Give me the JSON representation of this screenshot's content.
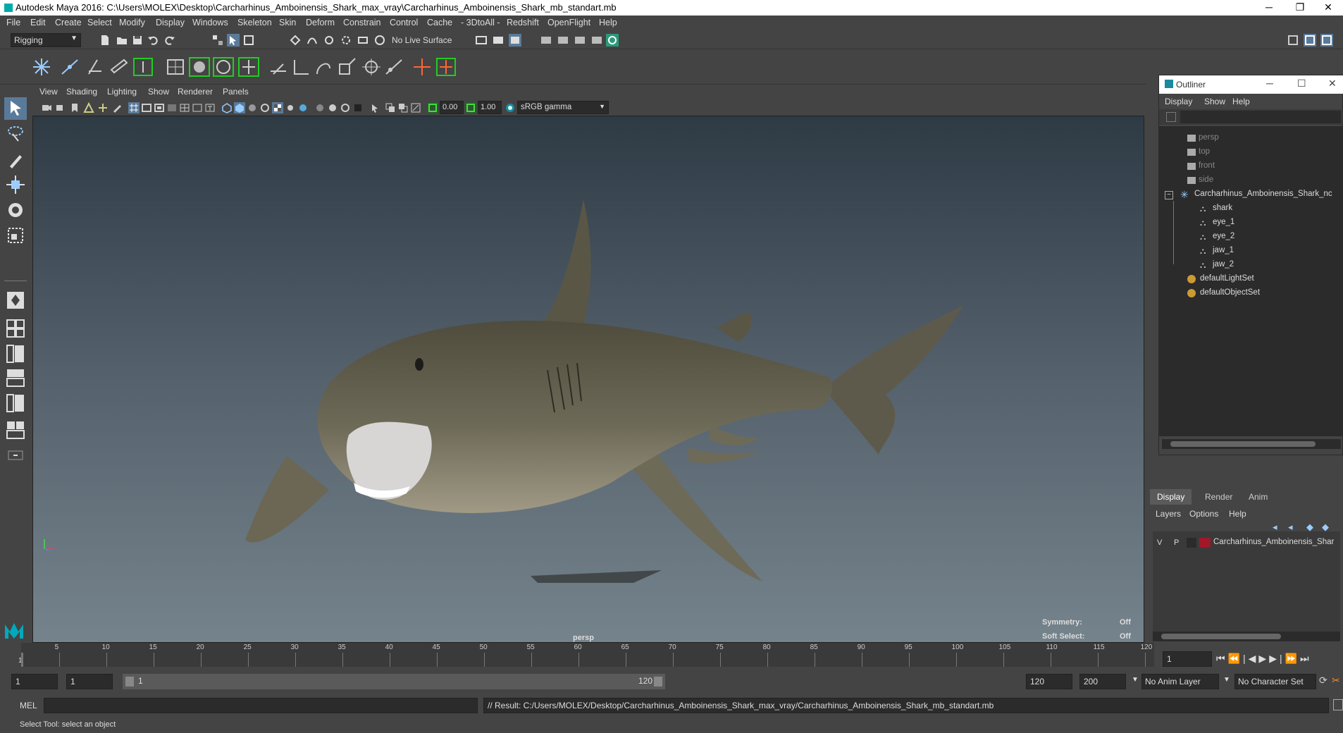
{
  "window": {
    "title": "Autodesk Maya 2016: C:\\Users\\MOLEX\\Desktop\\Carcharhinus_Amboinensis_Shark_max_vray\\Carcharhinus_Amboinensis_Shark_mb_standart.mb",
    "minimize": "─",
    "restore": "❐",
    "close": "✕"
  },
  "menubar": [
    "File",
    "Edit",
    "Create",
    "Select",
    "Modify",
    "Display",
    "Windows",
    "Skeleton",
    "Skin",
    "Deform",
    "Constrain",
    "Control",
    "Cache",
    "- 3DtoAll -",
    "Redshift",
    "OpenFlight",
    "Help"
  ],
  "status": {
    "mode": "Rigging",
    "live_surface": "No Live Surface"
  },
  "panel": {
    "menus": [
      "View",
      "Shading",
      "Lighting",
      "Show",
      "Renderer",
      "Panels"
    ],
    "exposure": "0.00",
    "gamma": "1.00",
    "colorspace": "sRGB gamma"
  },
  "viewport": {
    "camera": "persp",
    "symmetry_label": "Symmetry:",
    "symmetry_value": "Off",
    "soft_select_label": "Soft Select:",
    "soft_select_value": "Off"
  },
  "timeline": {
    "ticks": [
      "5",
      "10",
      "15",
      "20",
      "25",
      "30",
      "35",
      "40",
      "45",
      "50",
      "55",
      "60",
      "65",
      "70",
      "75",
      "80",
      "85",
      "90",
      "95",
      "100",
      "105",
      "110",
      "115",
      "120"
    ],
    "start_label": "1",
    "current_frame": "1"
  },
  "range": {
    "start": "1",
    "current": "1",
    "slider_start": "1",
    "slider_end": "120",
    "end": "120",
    "max": "200",
    "anim_layer": "No Anim Layer",
    "character_set": "No Character Set"
  },
  "cmd": {
    "lang": "MEL",
    "result": "// Result: C:/Users/MOLEX/Desktop/Carcharhinus_Amboinensis_Shark_max_vray/Carcharhinus_Amboinensis_Shark_mb_standart.mb"
  },
  "help_line": "Select Tool: select an object",
  "outliner": {
    "title": "Outliner",
    "menus": [
      "Display",
      "Show",
      "Help"
    ],
    "items": [
      {
        "label": "persp",
        "dim": true
      },
      {
        "label": "top",
        "dim": true
      },
      {
        "label": "front",
        "dim": true
      },
      {
        "label": "side",
        "dim": true
      },
      {
        "label": "Carcharhinus_Amboinensis_Shark_nc",
        "dim": false
      },
      {
        "label": "shark",
        "dim": false
      },
      {
        "label": "eye_1",
        "dim": false
      },
      {
        "label": "eye_2",
        "dim": false
      },
      {
        "label": "jaw_1",
        "dim": false
      },
      {
        "label": "jaw_2",
        "dim": false
      },
      {
        "label": "defaultLightSet",
        "dim": false
      },
      {
        "label": "defaultObjectSet",
        "dim": false
      }
    ]
  },
  "layers": {
    "tabs": [
      "Display",
      "Render",
      "Anim"
    ],
    "menus": [
      "Layers",
      "Options",
      "Help"
    ],
    "row": {
      "v": "V",
      "p": "P",
      "name": "Carcharhinus_Amboinensis_Shar",
      "color": "#a0182a"
    }
  }
}
